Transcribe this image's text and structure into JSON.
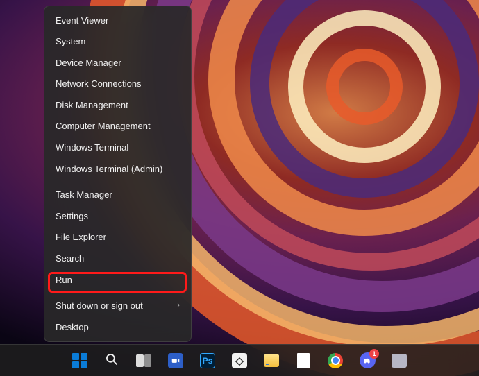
{
  "context_menu": {
    "groups": [
      {
        "items": [
          {
            "label": "Event Viewer",
            "submenu": false
          },
          {
            "label": "System",
            "submenu": false
          },
          {
            "label": "Device Manager",
            "submenu": false
          },
          {
            "label": "Network Connections",
            "submenu": false
          },
          {
            "label": "Disk Management",
            "submenu": false
          },
          {
            "label": "Computer Management",
            "submenu": false
          },
          {
            "label": "Windows Terminal",
            "submenu": false
          },
          {
            "label": "Windows Terminal (Admin)",
            "submenu": false
          }
        ]
      },
      {
        "items": [
          {
            "label": "Task Manager",
            "submenu": false
          },
          {
            "label": "Settings",
            "submenu": false
          },
          {
            "label": "File Explorer",
            "submenu": false
          },
          {
            "label": "Search",
            "submenu": false
          },
          {
            "label": "Run",
            "submenu": false,
            "highlighted": true
          }
        ]
      },
      {
        "items": [
          {
            "label": "Shut down or sign out",
            "submenu": true
          },
          {
            "label": "Desktop",
            "submenu": false
          }
        ]
      }
    ]
  },
  "taskbar": {
    "items": [
      {
        "name": "start-button",
        "icon": "start",
        "tooltip": "Start"
      },
      {
        "name": "search-button",
        "icon": "search",
        "tooltip": "Search"
      },
      {
        "name": "task-view-button",
        "icon": "taskview",
        "tooltip": "Task View"
      },
      {
        "name": "zoom-app",
        "icon": "zoom",
        "tooltip": "Zoom"
      },
      {
        "name": "photoshop-app",
        "icon": "ps",
        "tooltip": "Adobe Photoshop",
        "label": "Ps"
      },
      {
        "name": "roblox-app",
        "icon": "roblox",
        "tooltip": "Roblox"
      },
      {
        "name": "file-explorer-app",
        "icon": "folder",
        "tooltip": "File Explorer"
      },
      {
        "name": "document-app",
        "icon": "doc",
        "tooltip": "Document"
      },
      {
        "name": "chrome-app",
        "icon": "chrome",
        "tooltip": "Google Chrome"
      },
      {
        "name": "discord-app",
        "icon": "discord",
        "tooltip": "Discord",
        "badge": "1"
      },
      {
        "name": "misc-app",
        "icon": "generic",
        "tooltip": "Application"
      }
    ]
  },
  "highlight": {
    "target_label": "Run",
    "color": "#ff1a1a"
  }
}
